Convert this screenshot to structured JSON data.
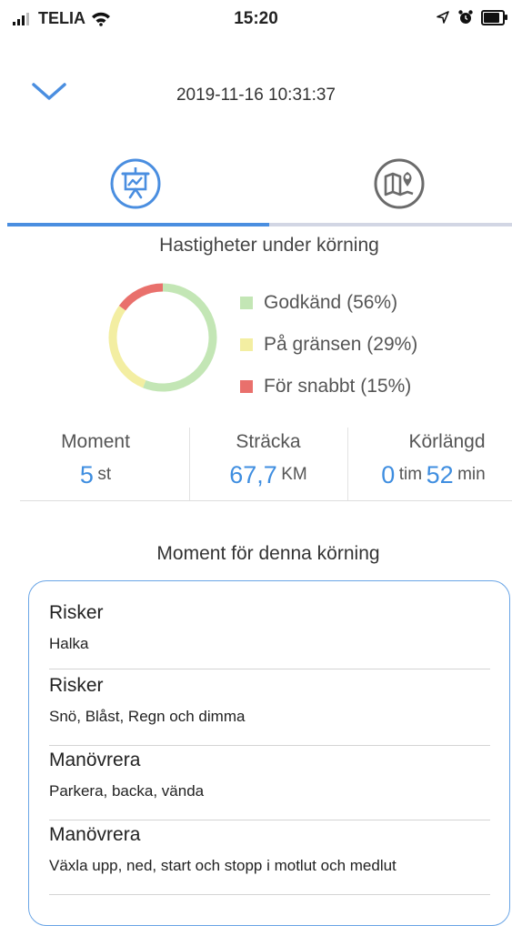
{
  "status_bar": {
    "carrier": "TELIA",
    "time": "15:20"
  },
  "header": {
    "datetime": "2019-11-16 10:31:37",
    "back_icon": "chevron-down-icon"
  },
  "tabs": [
    {
      "icon": "presentation-chart-icon",
      "active": true
    },
    {
      "icon": "map-pin-icon",
      "active": false
    }
  ],
  "speed": {
    "title": "Hastigheter under körning",
    "legend": [
      {
        "label": "Godkänd",
        "pct": "(56%)",
        "color": "#c3e6b5"
      },
      {
        "label": "På gränsen",
        "pct": "(29%)",
        "color": "#f3eea2"
      },
      {
        "label": "För snabbt",
        "pct": "(15%)",
        "color": "#e9706c"
      }
    ]
  },
  "chart_data": {
    "type": "pie",
    "categories": [
      "Godkänd",
      "På gränsen",
      "För snabbt"
    ],
    "values": [
      56,
      29,
      15
    ],
    "colors": [
      "#c3e6b5",
      "#f3eea2",
      "#e9706c"
    ],
    "title": "Hastigheter under körning"
  },
  "stats": {
    "moment": {
      "label": "Moment",
      "value": "5",
      "unit": "st"
    },
    "distance": {
      "label": "Sträcka",
      "value": "67,7",
      "unit": "KM"
    },
    "duration": {
      "label": "Körlängd",
      "hours": "0",
      "hours_unit": "tim",
      "minutes": "52",
      "minutes_unit": "min"
    }
  },
  "moments": {
    "title": "Moment för denna körning",
    "items": [
      {
        "title": "Risker",
        "detail": "Halka"
      },
      {
        "title": "Risker",
        "detail": "Snö, Blåst, Regn och dimma"
      },
      {
        "title": "Manövrera",
        "detail": "Parkera, backa, vända"
      },
      {
        "title": "Manövrera",
        "detail": "Växla upp, ned, start och stopp i motlut och medlut"
      }
    ]
  }
}
